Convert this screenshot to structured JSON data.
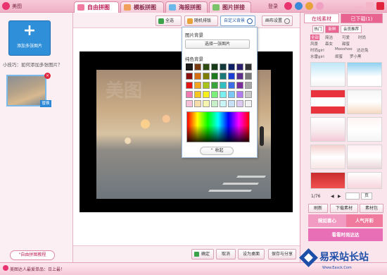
{
  "app": {
    "title": "美图"
  },
  "tabs": [
    {
      "label": "自由拼图"
    },
    {
      "label": "模板拼图"
    },
    {
      "label": "海报拼图"
    },
    {
      "label": "图片拼接"
    }
  ],
  "header": {
    "login_label": "登录"
  },
  "left": {
    "add_photos_label": "添加多张图片",
    "tip_text": "小技巧：如何添加多张图片？",
    "replace_label": "替换",
    "close_glyph": "×",
    "tutorial_label": "\"自由拼图教程"
  },
  "toolbar": {
    "select_all": "全选",
    "random": "随机排版",
    "custom_bg": "自定义背景",
    "canvas_set": "画布设置"
  },
  "canvas": {
    "watermark": "美图"
  },
  "dropdown": {
    "image_bg_label": "图片背景",
    "choose_image": "选择一张图片",
    "solid_label": "纯色背景",
    "collapse": "收起",
    "swatches": [
      "#1a1a1a",
      "#7a3b10",
      "#2f4d12",
      "#153a18",
      "#123a3a",
      "#0f1f66",
      "#2c1f6e",
      "#343434",
      "#8a0e0e",
      "#d66f14",
      "#7d7d00",
      "#1e7a1e",
      "#1a7a7a",
      "#1a3fd6",
      "#5c2d8a",
      "#7a7a7a",
      "#e41414",
      "#f2a61f",
      "#a8c41a",
      "#3aa33a",
      "#31bfbf",
      "#3a6fe8",
      "#7a2d9a",
      "#a8a8a8",
      "#f07ab2",
      "#f5c61f",
      "#f5f01a",
      "#7af07a",
      "#7aeff0",
      "#7ac8f5",
      "#b07af0",
      "#c8c8c8",
      "#f5c0d8",
      "#f5dca8",
      "#f5f5b0",
      "#c8f0c8",
      "#c8f5f5",
      "#c8e0f5",
      "#dcc8f0",
      "#f0f0f0"
    ]
  },
  "bottom": {
    "ok": "确定",
    "cancel": "取消",
    "set_desktop": "设为桌面",
    "save_share": "保存与分享"
  },
  "status": {
    "text": "美图达人最爱单品：日上最！"
  },
  "right": {
    "tab_online": "在线素材",
    "tab_downloaded": "已下载(1)",
    "content_tabs": [
      "热门",
      "新鲜",
      "会员推荐"
    ],
    "categories": [
      "全部",
      "简洁",
      "可爱",
      "时尚",
      "风景",
      "森女",
      "甜蜜",
      "时尚girl",
      "Mooshoo",
      "达达兔",
      "水雷girl",
      "闺蜜",
      "罗小黑"
    ],
    "pager": "1/76",
    "pager_btn": "页",
    "refresh": "刷新",
    "download": "下载素材",
    "library": "素材包",
    "promo1": "婉如喜心",
    "promo2": "人气开彩",
    "promo3": "看看时尚达达"
  },
  "logo": {
    "name": "易采站长站",
    "url": "Www.Easck.Com"
  }
}
